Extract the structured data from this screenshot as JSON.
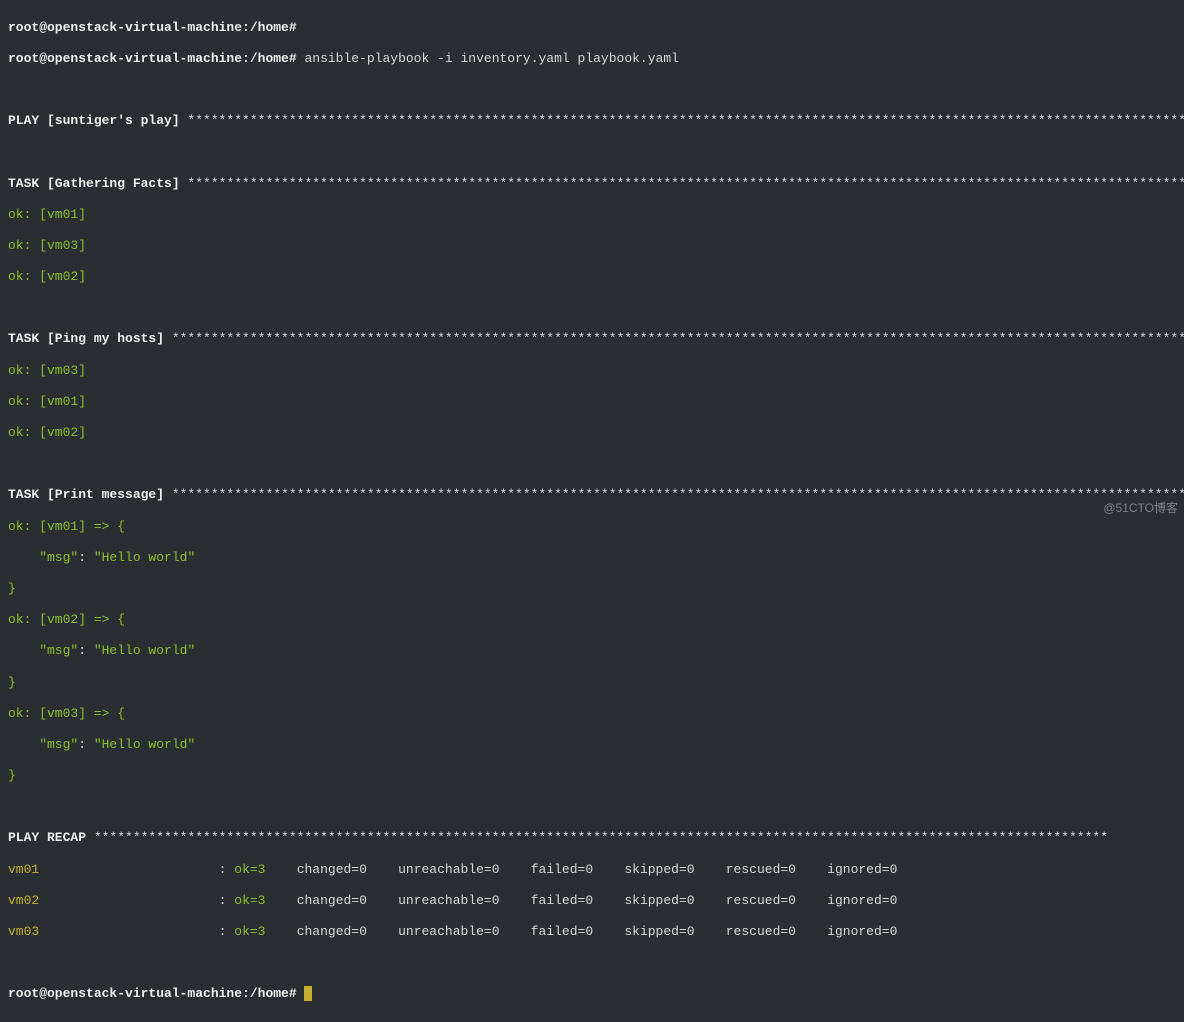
{
  "prompt1": "root@openstack-virtual-machine:/home#",
  "command": "ansible-playbook -i inventory.yaml playbook.yaml",
  "play_header": "PLAY [suntiger's play] ",
  "task_gather": "TASK [Gathering Facts] ",
  "gather_ok": [
    "ok: [vm01]",
    "ok: [vm03]",
    "ok: [vm02]"
  ],
  "task_ping": "TASK [Ping my hosts] ",
  "ping_ok": [
    "ok: [vm03]",
    "ok: [vm01]",
    "ok: [vm02]"
  ],
  "task_print": "TASK [Print message] ",
  "print_results": [
    {
      "host": "ok: [vm01] => {",
      "key": "    \"msg\"",
      "sep": ": ",
      "val": "\"Hello world\"",
      "close": "}"
    },
    {
      "host": "ok: [vm02] => {",
      "key": "    \"msg\"",
      "sep": ": ",
      "val": "\"Hello world\"",
      "close": "}"
    },
    {
      "host": "ok: [vm03] => {",
      "key": "    \"msg\"",
      "sep": ": ",
      "val": "\"Hello world\"",
      "close": "}"
    }
  ],
  "recap_header": "PLAY RECAP ",
  "recap_rows": [
    {
      "name": "vm01",
      "ok": "ok=3",
      "rest": "    changed=0    unreachable=0    failed=0    skipped=0    rescued=0    ignored=0"
    },
    {
      "name": "vm02",
      "ok": "ok=3",
      "rest": "    changed=0    unreachable=0    failed=0    skipped=0    rescued=0    ignored=0"
    },
    {
      "name": "vm03",
      "ok": "ok=3",
      "rest": "    changed=0    unreachable=0    failed=0    skipped=0    rescued=0    ignored=0"
    }
  ],
  "final_prompt": "root@openstack-virtual-machine:/home# ",
  "watermark": "@51CTO博客",
  "stars_long": "**********************************************************************************************************************************"
}
